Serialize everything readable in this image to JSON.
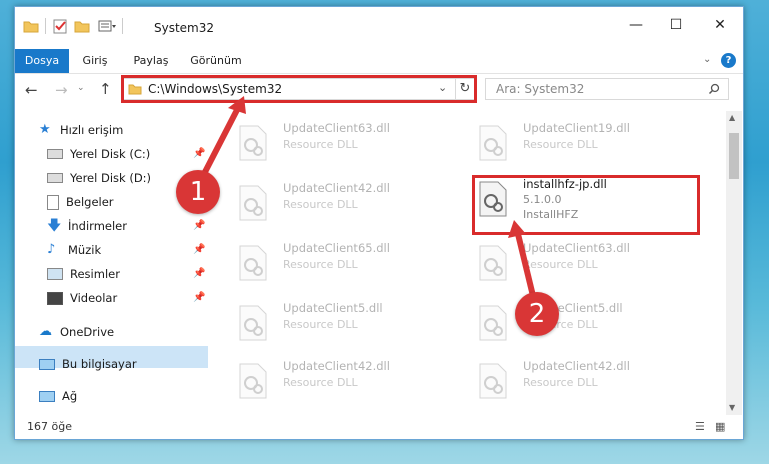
{
  "window": {
    "title": "System32"
  },
  "ribbon": {
    "tabs": [
      "Dosya",
      "Giriş",
      "Paylaş",
      "Görünüm"
    ]
  },
  "address": {
    "path": "C:\\Windows\\System32"
  },
  "search": {
    "placeholder": "Ara: System32"
  },
  "sidebar": {
    "items": [
      {
        "label": "Hızlı erişim"
      },
      {
        "label": "Yerel Disk (C:)"
      },
      {
        "label": "Yerel Disk (D:)"
      },
      {
        "label": "Belgeler"
      },
      {
        "label": "İndirmeler"
      },
      {
        "label": "Müzik"
      },
      {
        "label": "Resimler"
      },
      {
        "label": "Videolar"
      },
      {
        "label": "OneDrive"
      },
      {
        "label": "Bu bilgisayar"
      },
      {
        "label": "Ağ"
      }
    ]
  },
  "files": [
    {
      "name": "UpdateClient63.dll",
      "desc": "Resource DLL"
    },
    {
      "name": "UpdateClient19.dll",
      "desc": "Resource DLL"
    },
    {
      "name": "UpdateClient42.dll",
      "desc": "Resource DLL"
    },
    {
      "name": "installhfz-jp.dll",
      "desc": "5.1.0.0",
      "desc2": "InstallHFZ"
    },
    {
      "name": "UpdateClient65.dll",
      "desc": "Resource DLL"
    },
    {
      "name": "UpdateClient63.dll",
      "desc": "Resource DLL"
    },
    {
      "name": "UpdateClient5.dll",
      "desc": "Resource DLL"
    },
    {
      "name": "UpdateClient5.dll",
      "desc": "Resource DLL"
    },
    {
      "name": "UpdateClient42.dll",
      "desc": "Resource DLL"
    },
    {
      "name": "UpdateClient42.dll",
      "desc": "Resource DLL"
    }
  ],
  "status": {
    "count": "167 öğe"
  },
  "annotations": {
    "step1": "1",
    "step2": "2"
  },
  "colors": {
    "accent": "#1979ca",
    "highlight": "#d92b2b"
  }
}
